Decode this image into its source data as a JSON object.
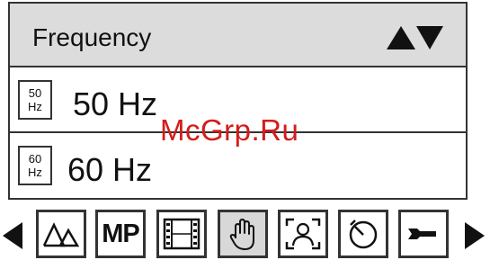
{
  "menu": {
    "title": "Frequency",
    "scroll_icon": "up-down-arrows-icon",
    "items": [
      {
        "badge_top": "50",
        "badge_bottom": "Hz",
        "label": "50 Hz"
      },
      {
        "badge_top": "60",
        "badge_bottom": "Hz",
        "label": "60 Hz"
      }
    ]
  },
  "toolbar": {
    "left_arrow_icon": "left-triangle-icon",
    "right_arrow_icon": "right-triangle-icon",
    "tools": [
      {
        "icon": "scene-mode-icon",
        "selected": false
      },
      {
        "icon": "mp-icon",
        "text": "MP",
        "selected": false
      },
      {
        "icon": "film-strip-icon",
        "selected": false
      },
      {
        "icon": "hand-icon",
        "selected": true
      },
      {
        "icon": "face-frame-icon",
        "selected": false
      },
      {
        "icon": "self-timer-icon",
        "selected": false
      },
      {
        "icon": "wrench-icon",
        "selected": false
      }
    ]
  },
  "watermark": "McGrp.Ru",
  "colors": {
    "header_bg": "#dcdcdc",
    "border": "#333333",
    "selected_tool_bg": "#d8d8d8",
    "watermark": "#d41c1c"
  }
}
